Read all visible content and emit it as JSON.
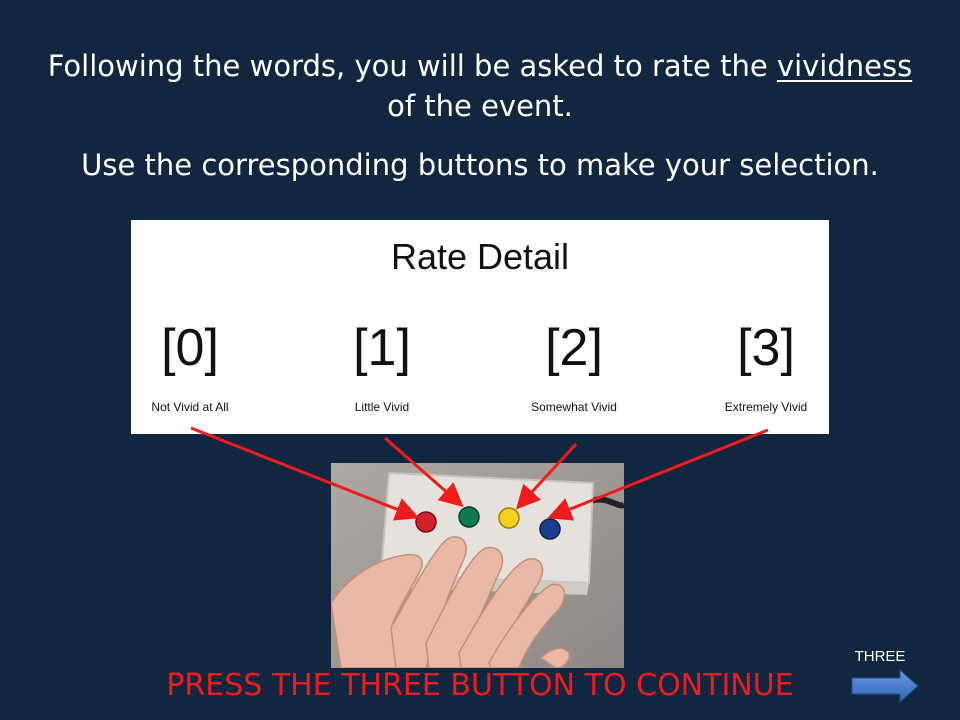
{
  "instructions": {
    "line1_pre": "Following the words, you will be asked to rate the ",
    "line1_emph": "vividness",
    "line1_post": " of the event.",
    "line2": "Use the corresponding buttons to make your selection."
  },
  "rating_panel": {
    "title": "Rate Detail",
    "options": [
      {
        "key": "[0]",
        "label": "Not Vivid at All"
      },
      {
        "key": "[1]",
        "label": "Little Vivid"
      },
      {
        "key": "[2]",
        "label": "Somewhat Vivid"
      },
      {
        "key": "[3]",
        "label": "Extremely Vivid"
      }
    ]
  },
  "button_box": {
    "button_colors": [
      "#d21f2c",
      "#0f7a52",
      "#f2d21b",
      "#1b3f8f"
    ]
  },
  "arrow_color": "#ee1c1c",
  "footer": {
    "prompt": "PRESS THE THREE BUTTON TO CONTINUE"
  },
  "nav": {
    "label": "THREE",
    "icon": "right-arrow-icon"
  }
}
